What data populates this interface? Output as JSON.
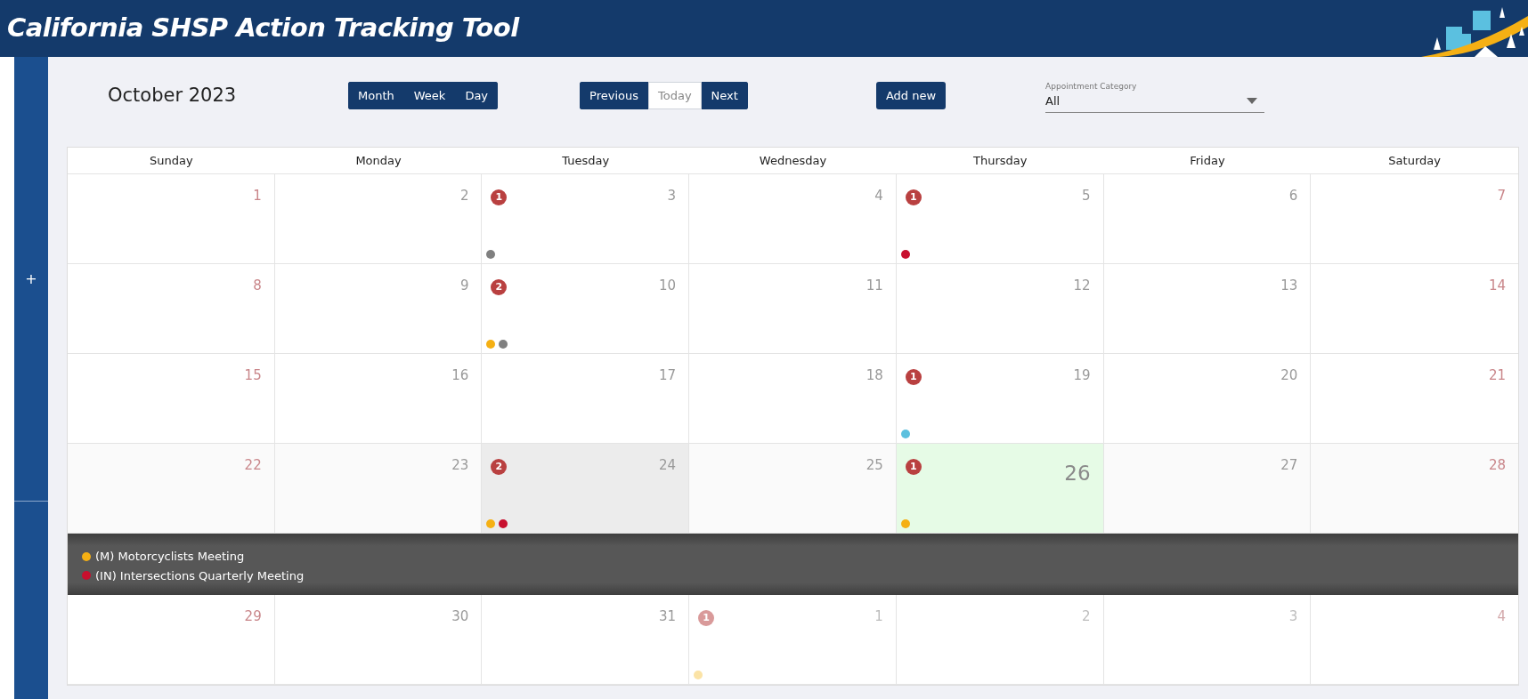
{
  "app_title": "California SHSP Action Tracking Tool",
  "sidebar": {
    "button": "+"
  },
  "toolbar": {
    "month_title": "October 2023",
    "view_buttons": [
      {
        "label": "Month",
        "kind": "solid"
      },
      {
        "label": "Week",
        "kind": "solid"
      },
      {
        "label": "Day",
        "kind": "solid"
      }
    ],
    "nav_buttons": [
      {
        "label": "Previous",
        "kind": "solid"
      },
      {
        "label": "Today",
        "kind": "outline"
      },
      {
        "label": "Next",
        "kind": "solid"
      }
    ],
    "add_button": "Add new",
    "category": {
      "label": "Appointment Category",
      "value": "All"
    }
  },
  "weekdays": [
    "Sunday",
    "Monday",
    "Tuesday",
    "Wednesday",
    "Thursday",
    "Friday",
    "Saturday"
  ],
  "weeks": [
    {
      "days": [
        {
          "day": "1",
          "weekend": true,
          "other_month": false,
          "selected": false,
          "today": false
        },
        {
          "day": "2",
          "weekend": false,
          "other_month": false,
          "selected": false,
          "today": false
        },
        {
          "day": "3",
          "weekend": false,
          "other_month": false,
          "selected": false,
          "today": false,
          "count": "1",
          "dots": [
            {
              "color": "#808080"
            }
          ]
        },
        {
          "day": "4",
          "weekend": false,
          "other_month": false,
          "selected": false,
          "today": false
        },
        {
          "day": "5",
          "weekend": false,
          "other_month": false,
          "selected": false,
          "today": false,
          "count": "1",
          "dots": [
            {
              "color": "#c8102e"
            }
          ]
        },
        {
          "day": "6",
          "weekend": false,
          "other_month": false,
          "selected": false,
          "today": false
        },
        {
          "day": "7",
          "weekend": true,
          "other_month": false,
          "selected": false,
          "today": false
        }
      ]
    },
    {
      "days": [
        {
          "day": "8",
          "weekend": true,
          "other_month": false,
          "selected": false,
          "today": false
        },
        {
          "day": "9",
          "weekend": false,
          "other_month": false,
          "selected": false,
          "today": false
        },
        {
          "day": "10",
          "weekend": false,
          "other_month": false,
          "selected": false,
          "today": false,
          "count": "2",
          "dots": [
            {
              "color": "#f5b014"
            },
            {
              "color": "#808080"
            }
          ]
        },
        {
          "day": "11",
          "weekend": false,
          "other_month": false,
          "selected": false,
          "today": false
        },
        {
          "day": "12",
          "weekend": false,
          "other_month": false,
          "selected": false,
          "today": false
        },
        {
          "day": "13",
          "weekend": false,
          "other_month": false,
          "selected": false,
          "today": false
        },
        {
          "day": "14",
          "weekend": true,
          "other_month": false,
          "selected": false,
          "today": false
        }
      ]
    },
    {
      "days": [
        {
          "day": "15",
          "weekend": true,
          "other_month": false,
          "selected": false,
          "today": false
        },
        {
          "day": "16",
          "weekend": false,
          "other_month": false,
          "selected": false,
          "today": false
        },
        {
          "day": "17",
          "weekend": false,
          "other_month": false,
          "selected": false,
          "today": false
        },
        {
          "day": "18",
          "weekend": false,
          "other_month": false,
          "selected": false,
          "today": false
        },
        {
          "day": "19",
          "weekend": false,
          "other_month": false,
          "selected": false,
          "today": false,
          "count": "1",
          "dots": [
            {
              "color": "#5bc0de"
            }
          ]
        },
        {
          "day": "20",
          "weekend": false,
          "other_month": false,
          "selected": false,
          "today": false
        },
        {
          "day": "21",
          "weekend": true,
          "other_month": false,
          "selected": false,
          "today": false
        }
      ]
    },
    {
      "days": [
        {
          "day": "22",
          "weekend": true,
          "other_month": false,
          "selected": false,
          "today": false
        },
        {
          "day": "23",
          "weekend": false,
          "other_month": false,
          "selected": false,
          "today": false
        },
        {
          "day": "24",
          "weekend": false,
          "other_month": false,
          "selected": true,
          "today": false,
          "count": "2",
          "dots": [
            {
              "color": "#f5b014"
            },
            {
              "color": "#c8102e"
            }
          ]
        },
        {
          "day": "25",
          "weekend": false,
          "other_month": false,
          "selected": false,
          "today": false
        },
        {
          "day": "26",
          "weekend": false,
          "other_month": false,
          "selected": false,
          "today": true,
          "count": "1",
          "dots": [
            {
              "color": "#f5b014"
            }
          ]
        },
        {
          "day": "27",
          "weekend": false,
          "other_month": false,
          "selected": false,
          "today": false
        },
        {
          "day": "28",
          "weekend": true,
          "other_month": false,
          "selected": false,
          "today": false
        }
      ],
      "events": [
        {
          "color": "#f5b014",
          "label": "(M) Motorcyclists Meeting"
        },
        {
          "color": "#c8102e",
          "label": "(IN) Intersections Quarterly Meeting"
        }
      ]
    },
    {
      "days": [
        {
          "day": "29",
          "weekend": true,
          "other_month": false,
          "selected": false,
          "today": false
        },
        {
          "day": "30",
          "weekend": false,
          "other_month": false,
          "selected": false,
          "today": false
        },
        {
          "day": "31",
          "weekend": false,
          "other_month": false,
          "selected": false,
          "today": false
        },
        {
          "day": "1",
          "weekend": false,
          "other_month": true,
          "selected": false,
          "today": false,
          "count": "1",
          "dots": [
            {
              "color": "#fbe3a6"
            }
          ]
        },
        {
          "day": "2",
          "weekend": false,
          "other_month": true,
          "selected": false,
          "today": false
        },
        {
          "day": "3",
          "weekend": false,
          "other_month": true,
          "selected": false,
          "today": false
        },
        {
          "day": "4",
          "weekend": true,
          "other_month": true,
          "selected": false,
          "today": false
        }
      ]
    }
  ]
}
